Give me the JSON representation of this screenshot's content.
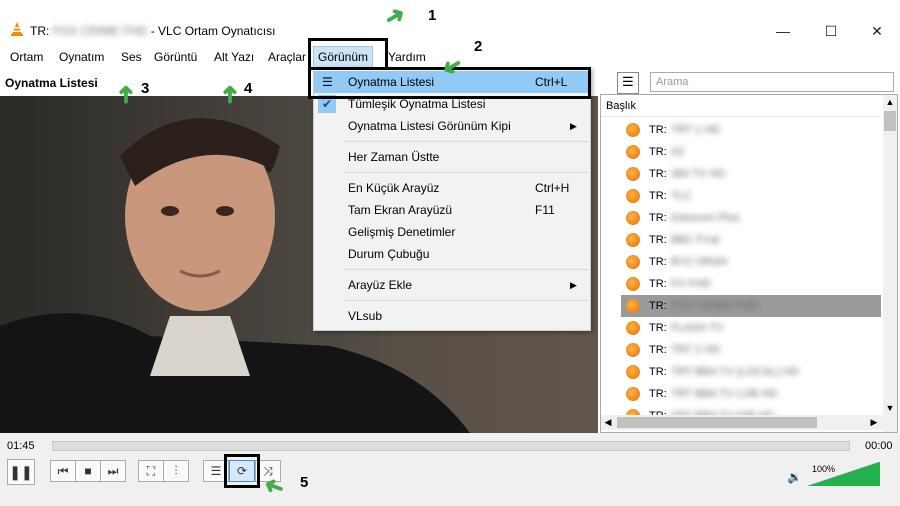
{
  "window": {
    "title_prefix": "TR:",
    "title_blurred": "FOX CRIME FHD",
    "title_suffix": "- VLC Ortam Oynatıcısı",
    "min_glyph": "—",
    "max_glyph": "☐",
    "close_glyph": "✕"
  },
  "menubar": [
    "Ortam",
    "Oynatım",
    "Ses",
    "Görüntü",
    "Alt Yazı",
    "Araçlar",
    "Görünüm",
    "Yardım"
  ],
  "playlist_label": "Oynatma Listesi",
  "dropdown": {
    "items": [
      {
        "label": "Oynatma Listesi",
        "shortcut": "Ctrl+L"
      },
      {
        "label": "Tümleşik Oynatma Listesi",
        "shortcut": ""
      },
      {
        "label": "Oynatma Listesi Görünüm Kipi",
        "shortcut": ""
      },
      {
        "label": "Her Zaman Üstte",
        "shortcut": ""
      },
      {
        "label": "En Küçük Arayüz",
        "shortcut": "Ctrl+H"
      },
      {
        "label": "Tam Ekran Arayüzü",
        "shortcut": "F11"
      },
      {
        "label": "Gelişmiş Denetimler",
        "shortcut": ""
      },
      {
        "label": "Durum Çubuğu",
        "shortcut": ""
      },
      {
        "label": "Arayüz Ekle",
        "shortcut": ""
      },
      {
        "label": "VLsub",
        "shortcut": ""
      }
    ]
  },
  "search": {
    "placeholder": "Arama"
  },
  "playlist": {
    "column_header": "Başlık",
    "prefix": "TR:",
    "rows": [
      "TRT 1 HD",
      "A2",
      "360 TV HD",
      "TLC",
      "Dolunum Plus",
      "BBC Fırat",
      "BYZ ORAN",
      "FX FHD",
      "FOX CRIME FHD",
      "FLASH TV",
      "TRT 2 HD",
      "TRT BBA TV (LOCAL) HD",
      "TRT BBA TV LOB HD",
      "TRT BBA TV DIR HD"
    ],
    "selected_index": 8
  },
  "player": {
    "elapsed": "01:45",
    "total": "00:00",
    "volume": "100%",
    "volume_level": 1.0
  },
  "annotations": [
    "1",
    "2",
    "3",
    "4",
    "5"
  ],
  "colors": {
    "accent": "#91c9f7",
    "annotation_arrow": "#3fae49",
    "volume_fill": "#22b14c"
  }
}
